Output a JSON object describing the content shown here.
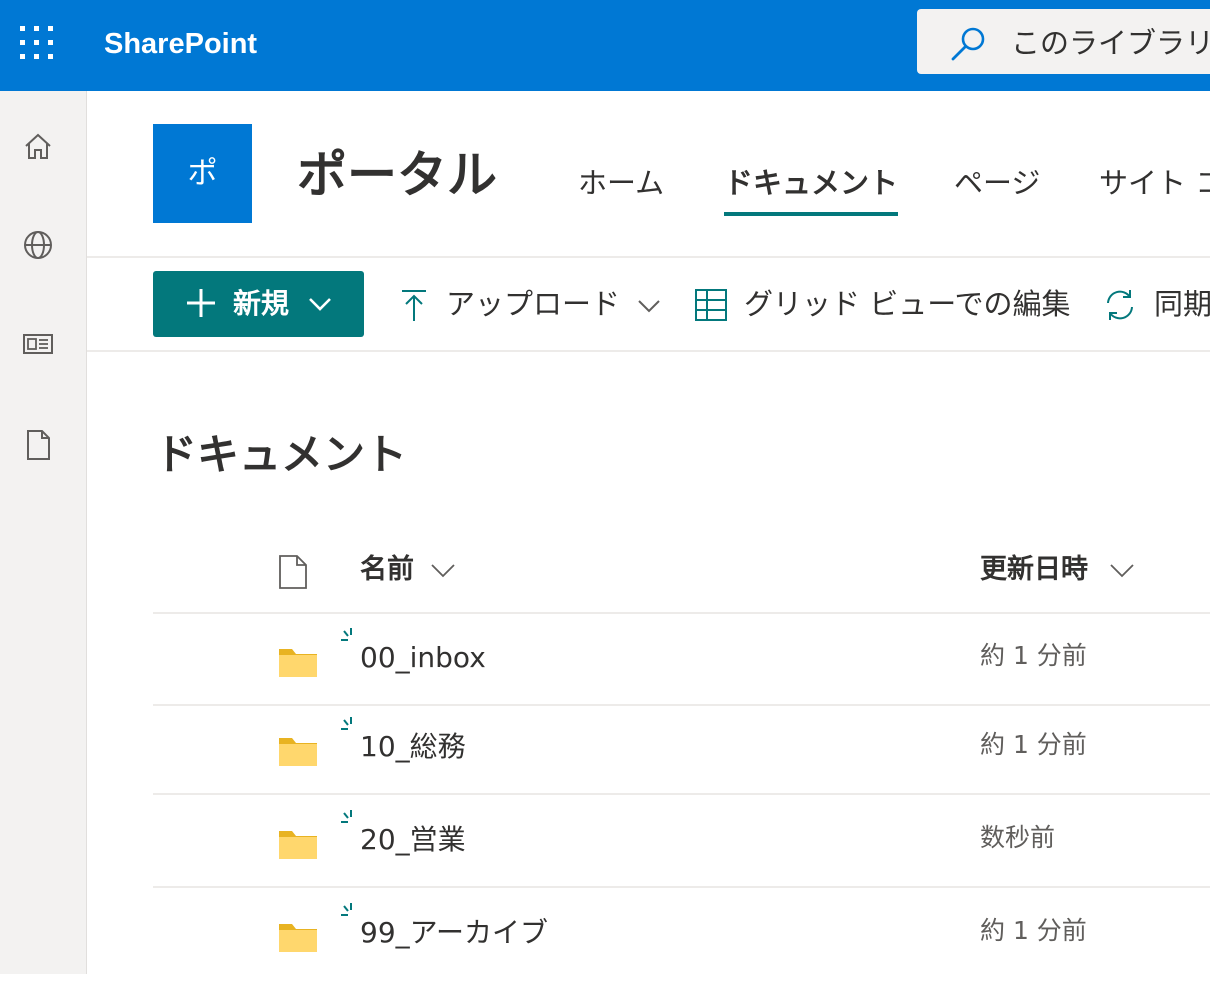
{
  "suite": {
    "brand": "SharePoint",
    "search_placeholder": "このライブラリ"
  },
  "site": {
    "logo_letter": "ポ",
    "title": "ポータル",
    "nav": [
      "ホーム",
      "ドキュメント",
      "ページ",
      "サイト コ"
    ],
    "active_nav": "ドキュメント"
  },
  "commands": {
    "new_label": "新規",
    "upload_label": "アップロード",
    "grid_label": "グリッド ビューでの編集",
    "sync_label": "同期"
  },
  "library": {
    "title": "ドキュメント",
    "columns": {
      "name": "名前",
      "modified": "更新日時"
    },
    "rows": [
      {
        "name": "00_inbox",
        "modified": "約 1 分前"
      },
      {
        "name": "10_総務",
        "modified": "約 1 分前"
      },
      {
        "name": "20_営業",
        "modified": "数秒前"
      },
      {
        "name": "99_アーカイブ",
        "modified": "約 1 分前"
      }
    ]
  },
  "colors": {
    "suite_blue": "#0078d4",
    "theme_teal": "#03787c",
    "folder_yellow": "#ffd76d"
  }
}
